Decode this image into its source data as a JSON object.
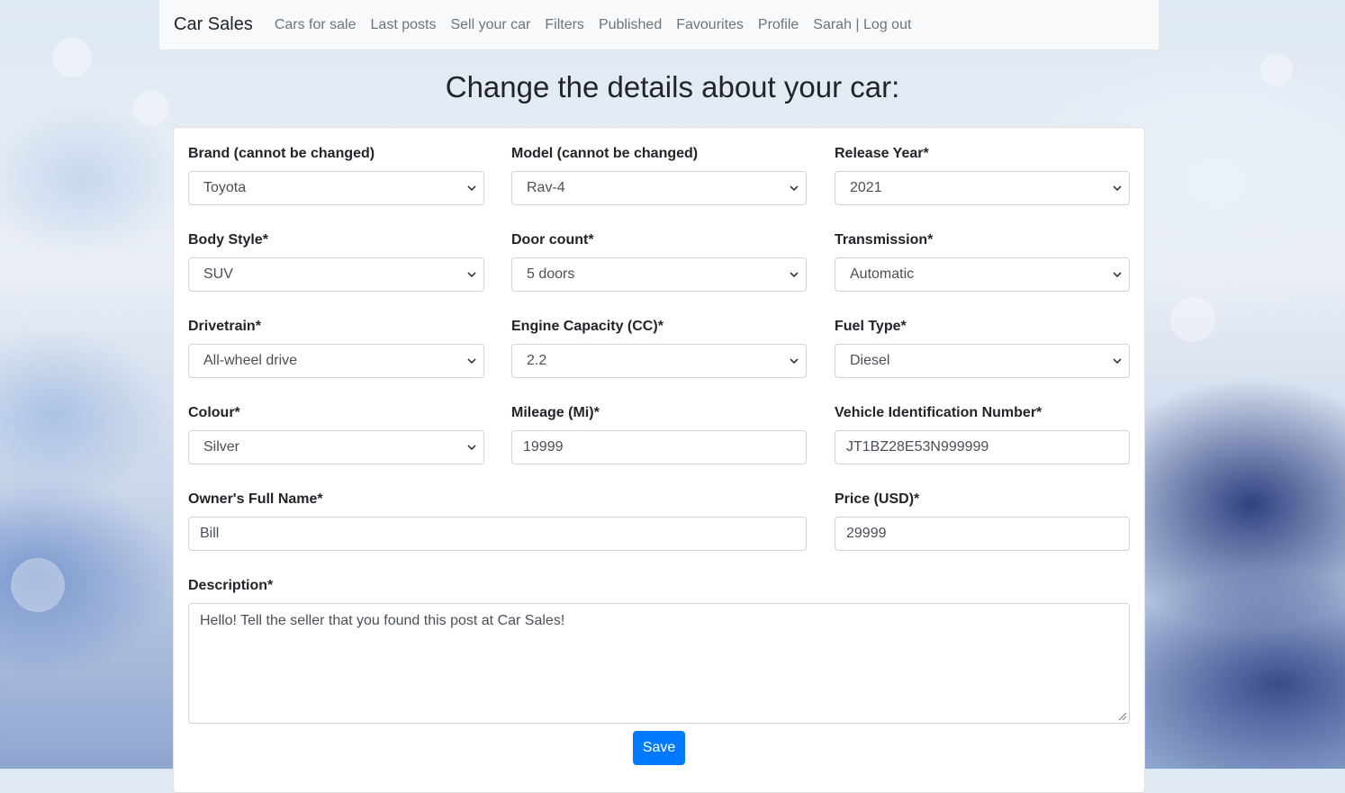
{
  "navbar": {
    "brand": "Car Sales",
    "links": [
      "Cars for sale",
      "Last posts",
      "Sell your car",
      "Filters",
      "Published",
      "Favourites",
      "Profile",
      "Sarah | Log out"
    ]
  },
  "page": {
    "title": "Change the details about your car:"
  },
  "form": {
    "brand": {
      "label": "Brand (cannot be changed)",
      "value": "Toyota"
    },
    "model": {
      "label": "Model (cannot be changed)",
      "value": "Rav-4"
    },
    "release_year": {
      "label": "Release Year*",
      "value": "2021"
    },
    "body_style": {
      "label": "Body Style*",
      "value": "SUV"
    },
    "door_count": {
      "label": "Door count*",
      "value": "5 doors"
    },
    "transmission": {
      "label": "Transmission*",
      "value": "Automatic"
    },
    "drivetrain": {
      "label": "Drivetrain*",
      "value": "All-wheel drive"
    },
    "engine_capacity": {
      "label": "Engine Capacity (CC)*",
      "value": "2.2"
    },
    "fuel_type": {
      "label": "Fuel Type*",
      "value": "Diesel"
    },
    "colour": {
      "label": "Colour*",
      "value": "Silver"
    },
    "mileage": {
      "label": "Mileage (Mi)*",
      "value": "19999"
    },
    "vin": {
      "label": "Vehicle Identification Number*",
      "value": "JT1BZ28E53N999999"
    },
    "owner_name": {
      "label": "Owner's Full Name*",
      "value": "Bill"
    },
    "price": {
      "label": "Price (USD)*",
      "value": "29999"
    },
    "description": {
      "label": "Description*",
      "value": "Hello! Tell the seller that you found this post at Car Sales!"
    },
    "save_label": "Save"
  },
  "icons": {
    "select_arrow": "chevron-down-icon",
    "resize": "resize-handle-icon"
  },
  "colors": {
    "primary": "#007bff",
    "navbar_bg": "#f8f9fa",
    "muted_link": "#6c757d"
  }
}
